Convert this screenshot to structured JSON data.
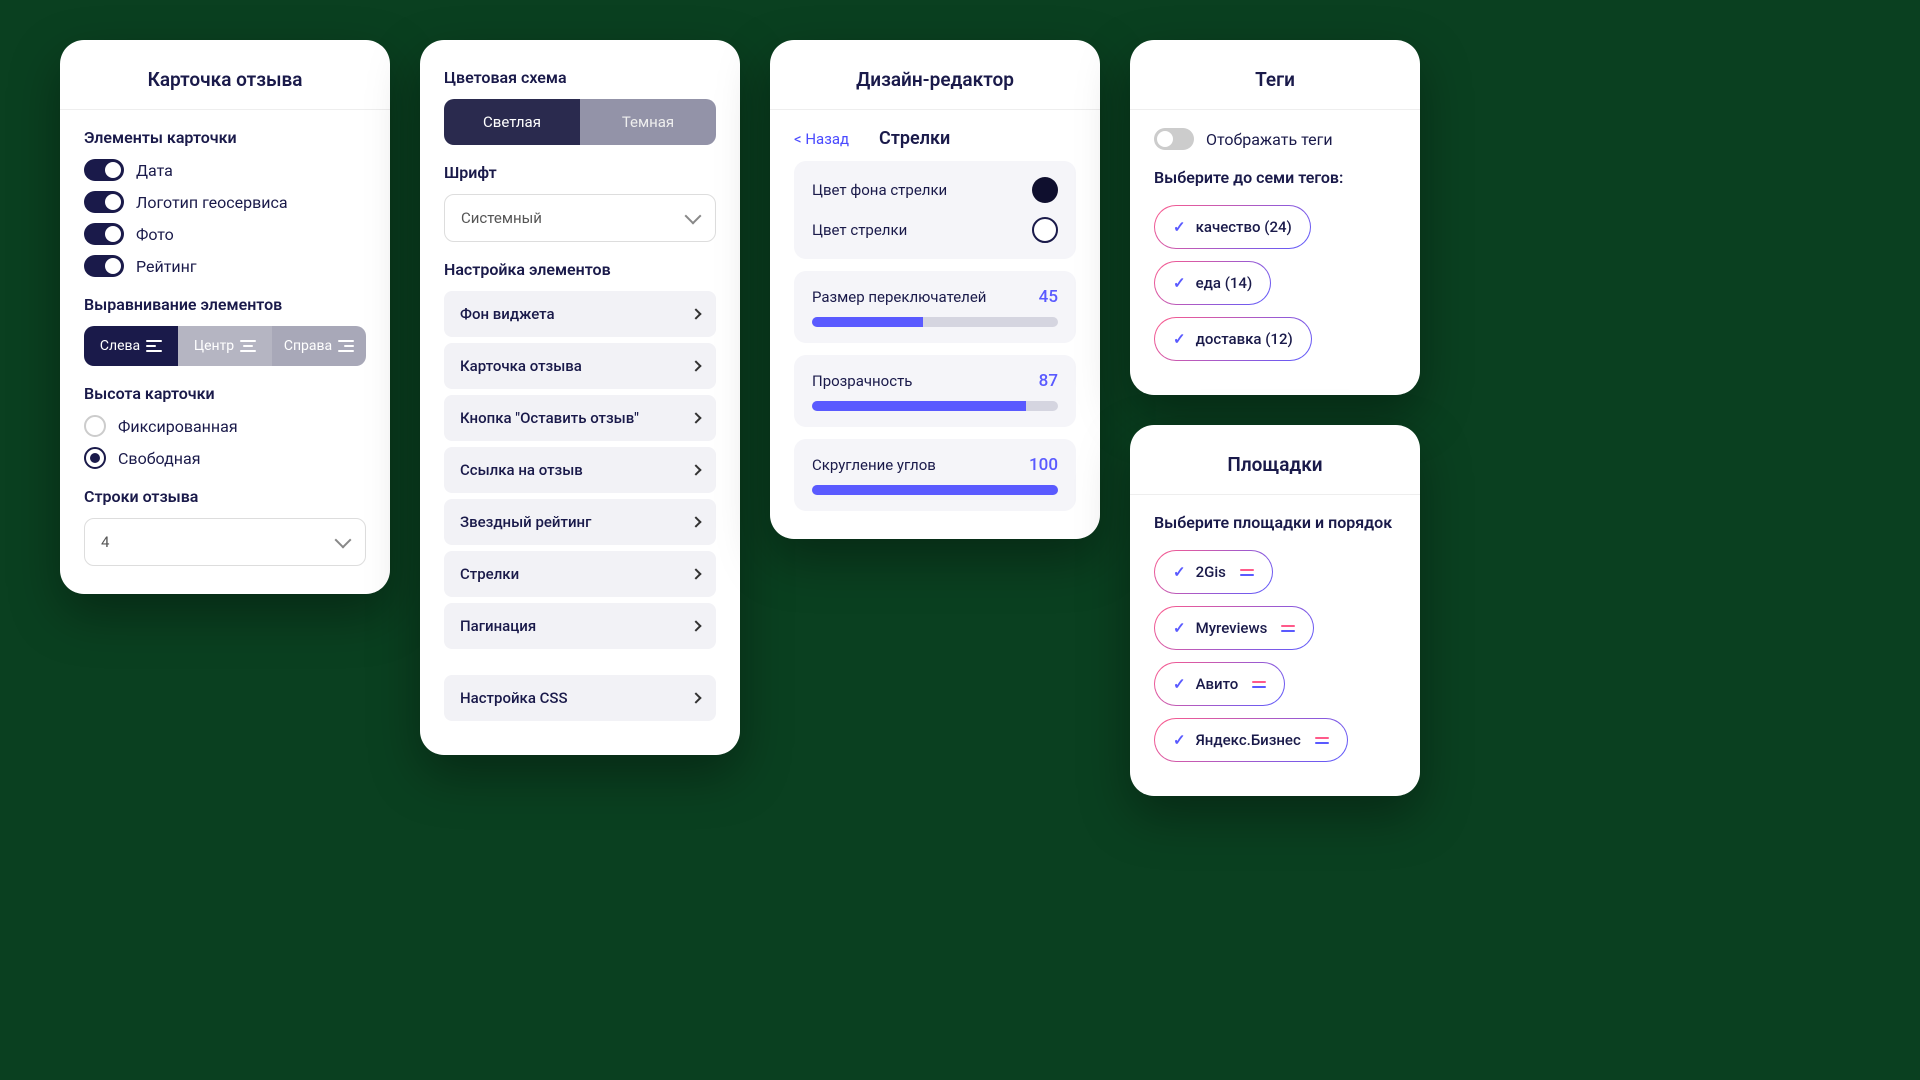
{
  "card1": {
    "title": "Карточка отзыва",
    "section_elements": "Элементы карточки",
    "toggles": [
      {
        "label": "Дата"
      },
      {
        "label": "Логотип геосервиса"
      },
      {
        "label": "Фото"
      },
      {
        "label": "Рейтинг"
      }
    ],
    "section_align": "Выравнивание элементов",
    "align_options": {
      "left": "Слева",
      "center": "Центр",
      "right": "Справа"
    },
    "section_height": "Высота карточки",
    "height_options": {
      "fixed": "Фиксированная",
      "free": "Свободная"
    },
    "section_lines": "Строки отзыва",
    "lines_value": "4"
  },
  "card2": {
    "section_theme": "Цветовая схема",
    "theme_light": "Светлая",
    "theme_dark": "Темная",
    "section_font": "Шрифт",
    "font_value": "Системный",
    "section_settings": "Настройка элементов",
    "nav_items": [
      "Фон виджета",
      "Карточка отзыва",
      "Кнопка \"Оставить отзыв\"",
      "Ссылка на отзыв",
      "Звездный рейтинг",
      "Стрелки",
      "Пагинация"
    ],
    "css_label": "Настройка CSS"
  },
  "card3": {
    "title": "Дизайн-редактор",
    "back": "< Назад",
    "subtitle": "Стрелки",
    "row_bg": "Цвет фона стрелки",
    "row_color": "Цвет стрелки",
    "row_size": "Размер переключателей",
    "row_size_val": "45",
    "row_opacity": "Прозрачность",
    "row_opacity_val": "87",
    "row_radius": "Скругление углов",
    "row_radius_val": "100"
  },
  "tags": {
    "title": "Теги",
    "show_label": "Отображать теги",
    "instruction": "Выберите до семи тегов:",
    "items": [
      "качество (24)",
      "еда (14)",
      "доставка (12)"
    ]
  },
  "platforms": {
    "title": "Площадки",
    "instruction": "Выберите площадки и порядок",
    "items": [
      "2Gis",
      "Myreviews",
      "Авито",
      "Яндекс.Бизнес"
    ]
  }
}
